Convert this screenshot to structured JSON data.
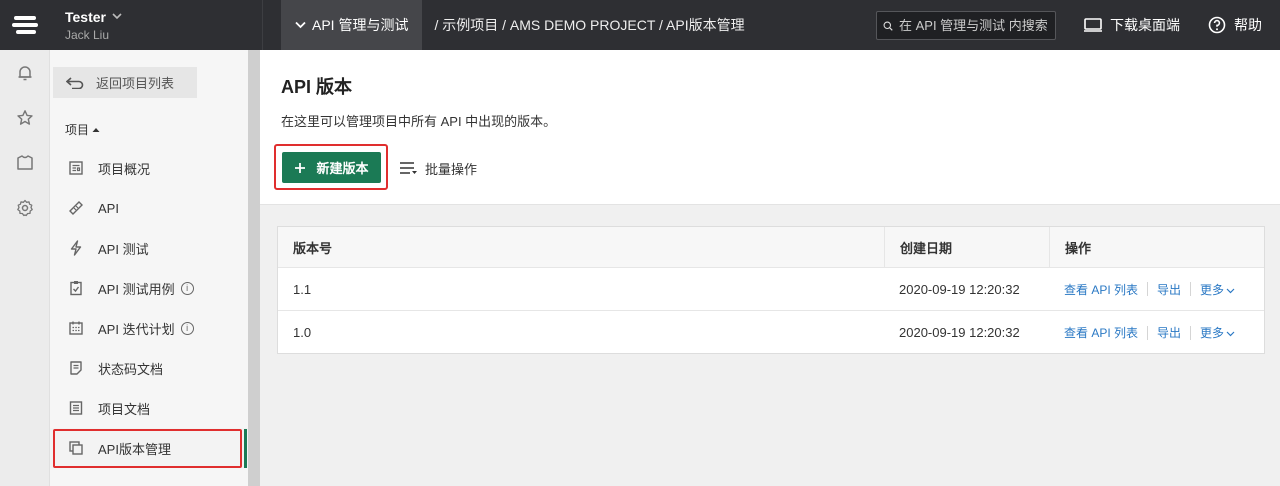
{
  "topbar": {
    "user_name": "Tester",
    "user_sub": "Jack Liu",
    "module_label": "API 管理与测试",
    "breadcrumb": "/ 示例项目 / AMS DEMO PROJECT / API版本管理",
    "search_placeholder": "在 API 管理与测试 内搜索",
    "download_label": "下载桌面端",
    "help_label": "帮助"
  },
  "sidebar": {
    "back_label": "返回项目列表",
    "section_label": "项目",
    "items": [
      {
        "label": "项目概况",
        "icon": "overview-icon"
      },
      {
        "label": "API",
        "icon": "api-icon"
      },
      {
        "label": "API 测试",
        "icon": "lightning-icon"
      },
      {
        "label": "API 测试用例",
        "icon": "clipboard-check-icon",
        "info": true
      },
      {
        "label": "API 迭代计划",
        "icon": "calendar-icon",
        "info": true
      },
      {
        "label": "状态码文档",
        "icon": "doc-icon"
      },
      {
        "label": "项目文档",
        "icon": "list-doc-icon"
      },
      {
        "label": "API版本管理",
        "icon": "versions-icon",
        "active": true
      }
    ]
  },
  "main": {
    "title": "API 版本",
    "description": "在这里可以管理项目中所有 API 中出现的版本。",
    "new_button": "新建版本",
    "bulk_button": "批量操作"
  },
  "table": {
    "headers": [
      "版本号",
      "创建日期",
      "操作"
    ],
    "rows": [
      {
        "version": "1.1",
        "date": "2020-09-19 12:20:32"
      },
      {
        "version": "1.0",
        "date": "2020-09-19 12:20:32"
      }
    ],
    "actions": {
      "view": "查看 API 列表",
      "export": "导出",
      "more": "更多"
    }
  },
  "colors": {
    "accent": "#1b7a55",
    "topbar": "#2e2f33",
    "highlight": "#e02e2e",
    "link": "#2a78c4"
  }
}
